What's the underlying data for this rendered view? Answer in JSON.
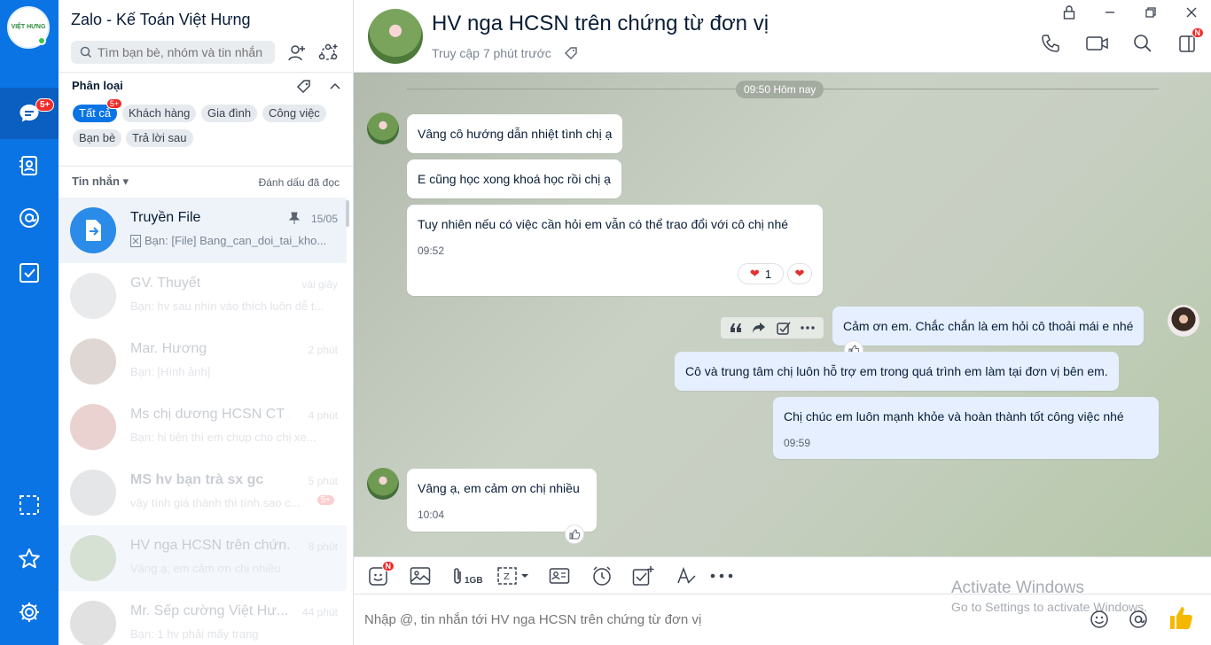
{
  "app": {
    "title": "Zalo - Kế Toán Việt Hưng",
    "logo_text": "VIỆT HƯNG",
    "nav_badge": "5+"
  },
  "search": {
    "placeholder": "Tìm bạn bè, nhóm và tin nhắn"
  },
  "categories": {
    "title": "Phân loại",
    "chips": [
      {
        "label": "Tất cả",
        "badge": "5+"
      },
      {
        "label": "Khách hàng"
      },
      {
        "label": "Gia đình"
      },
      {
        "label": "Công việc"
      },
      {
        "label": "Bạn bè"
      },
      {
        "label": "Trả lời sau"
      }
    ]
  },
  "messages_header": {
    "left": "Tin nhắn",
    "right": "Đánh dấu đã đọc"
  },
  "conversations": [
    {
      "name": "Truyền File",
      "time": "15/05",
      "preview": "Bạn: [File] Bang_can_doi_tai_kho..."
    },
    {
      "name": "GV. Thuyết",
      "time": "vài giây",
      "preview": "Bạn: hv sau nhìn vào thích luôn dễ t..."
    },
    {
      "name": "Mar. Hương",
      "time": "2 phút",
      "preview": "Bạn: [Hình ảnh]"
    },
    {
      "name": "Ms chị dương HCSN CT ...",
      "time": "4 phút",
      "preview": "Bạn: hi tiện thì em chụp cho chị xe..."
    },
    {
      "name": "MS hv bạn trà sx gc",
      "time": "5 phút",
      "preview": "vậy tính giá thành thì tính sao c...",
      "badge": "5+"
    },
    {
      "name": "HV nga HCSN trên chứn...",
      "time": "8 phút",
      "preview": "Vâng ạ, em cảm ơn chị nhiều"
    },
    {
      "name": "Mr. Sếp cường Việt Hư...",
      "time": "44 phút",
      "preview": "Bạn: 1 hv phải mấy trang"
    }
  ],
  "chat": {
    "title": "HV nga HCSN trên chứng từ đơn vị",
    "status": "Truy cập 7 phút trước",
    "date_divider": "09:50 Hôm nay",
    "messages": [
      {
        "text": "Vâng cô hướng dẫn nhiệt tình chị ạ"
      },
      {
        "text": "E cũng học xong khoá học rồi chị ạ"
      },
      {
        "text": "Tuy nhiên nếu có việc cần hỏi em vẫn có thể trao đổi với cô chị nhé",
        "time": "09:52",
        "reaction_count": "1"
      },
      {
        "text": "Cảm ơn em. Chắc chắn là em hỏi cô thoải mái e nhé"
      },
      {
        "text": "Cô và trung tâm chị luôn hỗ trợ em trong  quá trình em làm tại đơn vị bên em."
      },
      {
        "text": "Chị chúc em luôn mạnh khỏe và hoàn thành tốt công việc nhé",
        "time": "09:59"
      },
      {
        "text": "Vâng ạ, em cảm ơn chị nhiều",
        "time": "10:04"
      }
    ]
  },
  "toolbar": {
    "sticker_badge": "N",
    "file_size": "1GB",
    "call_badge": "N"
  },
  "composer": {
    "placeholder": "Nhập @, tin nhắn tới HV nga HCSN trên chứng từ đơn vị"
  },
  "watermark": {
    "line1": "Activate Windows",
    "line2": "Go to Settings to activate Windows."
  }
}
